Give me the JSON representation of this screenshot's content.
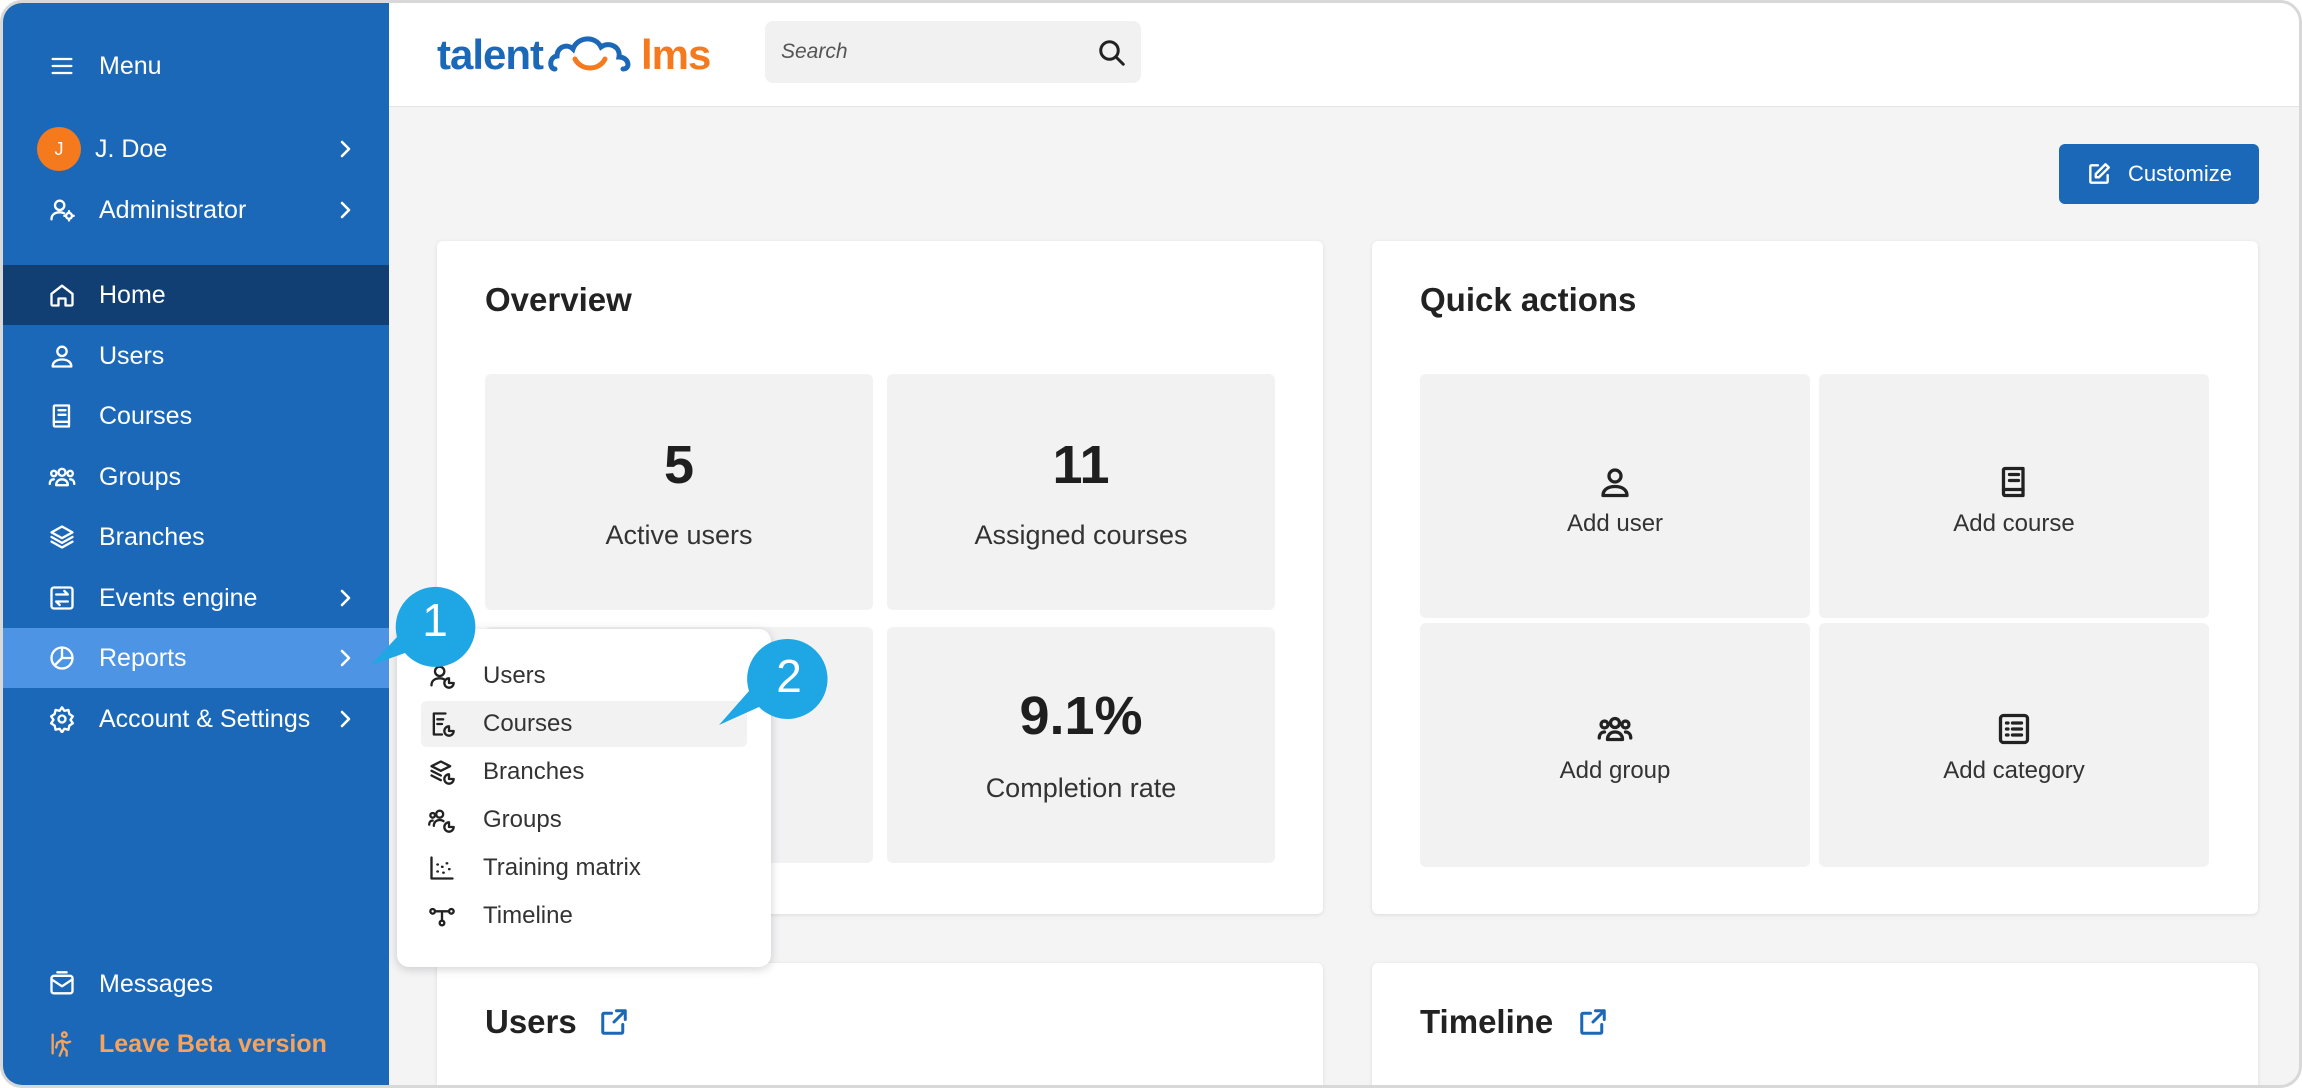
{
  "colors": {
    "sidebar_bg": "#1c68b8",
    "sidebar_active": "#113f74",
    "sidebar_highlight": "#4d94e4",
    "accent_orange": "#f47a1d",
    "callout": "#1ea7e4",
    "primary_button": "#1c68b8"
  },
  "sidebar": {
    "menu_label": "Menu",
    "user": {
      "initial": "J",
      "name": "J. Doe"
    },
    "role_label": "Administrator",
    "items": [
      {
        "label": "Home",
        "icon": "home-icon"
      },
      {
        "label": "Users",
        "icon": "user-icon"
      },
      {
        "label": "Courses",
        "icon": "book-icon"
      },
      {
        "label": "Groups",
        "icon": "group-icon"
      },
      {
        "label": "Branches",
        "icon": "layers-icon"
      },
      {
        "label": "Events engine",
        "icon": "events-icon"
      },
      {
        "label": "Reports",
        "icon": "pie-chart-icon"
      },
      {
        "label": "Account & Settings",
        "icon": "gear-icon"
      }
    ],
    "messages_label": "Messages",
    "leave_beta_label": "Leave Beta version"
  },
  "header": {
    "logo_left": "talent",
    "logo_right": "lms",
    "search_placeholder": "Search"
  },
  "customize_label": "Customize",
  "overview": {
    "title": "Overview",
    "stats": [
      {
        "value": "5",
        "label": "Active users"
      },
      {
        "value": "11",
        "label": "Assigned courses"
      },
      {
        "value": "9.1%",
        "label": "Completion rate"
      }
    ]
  },
  "quick_actions": {
    "title": "Quick actions",
    "items": [
      {
        "label": "Add user",
        "icon": "user-icon"
      },
      {
        "label": "Add course",
        "icon": "book-icon"
      },
      {
        "label": "Add group",
        "icon": "group-icon"
      },
      {
        "label": "Add category",
        "icon": "list-icon"
      }
    ]
  },
  "users_card": {
    "title": "Users"
  },
  "timeline_card": {
    "title": "Timeline"
  },
  "reports_menu": {
    "items": [
      {
        "label": "Users",
        "icon": "user-report-icon"
      },
      {
        "label": "Courses",
        "icon": "course-report-icon"
      },
      {
        "label": "Branches",
        "icon": "branch-report-icon"
      },
      {
        "label": "Groups",
        "icon": "group-report-icon"
      },
      {
        "label": "Training matrix",
        "icon": "scatter-icon"
      },
      {
        "label": "Timeline",
        "icon": "timeline-icon"
      }
    ]
  },
  "callouts": [
    "1",
    "2"
  ]
}
